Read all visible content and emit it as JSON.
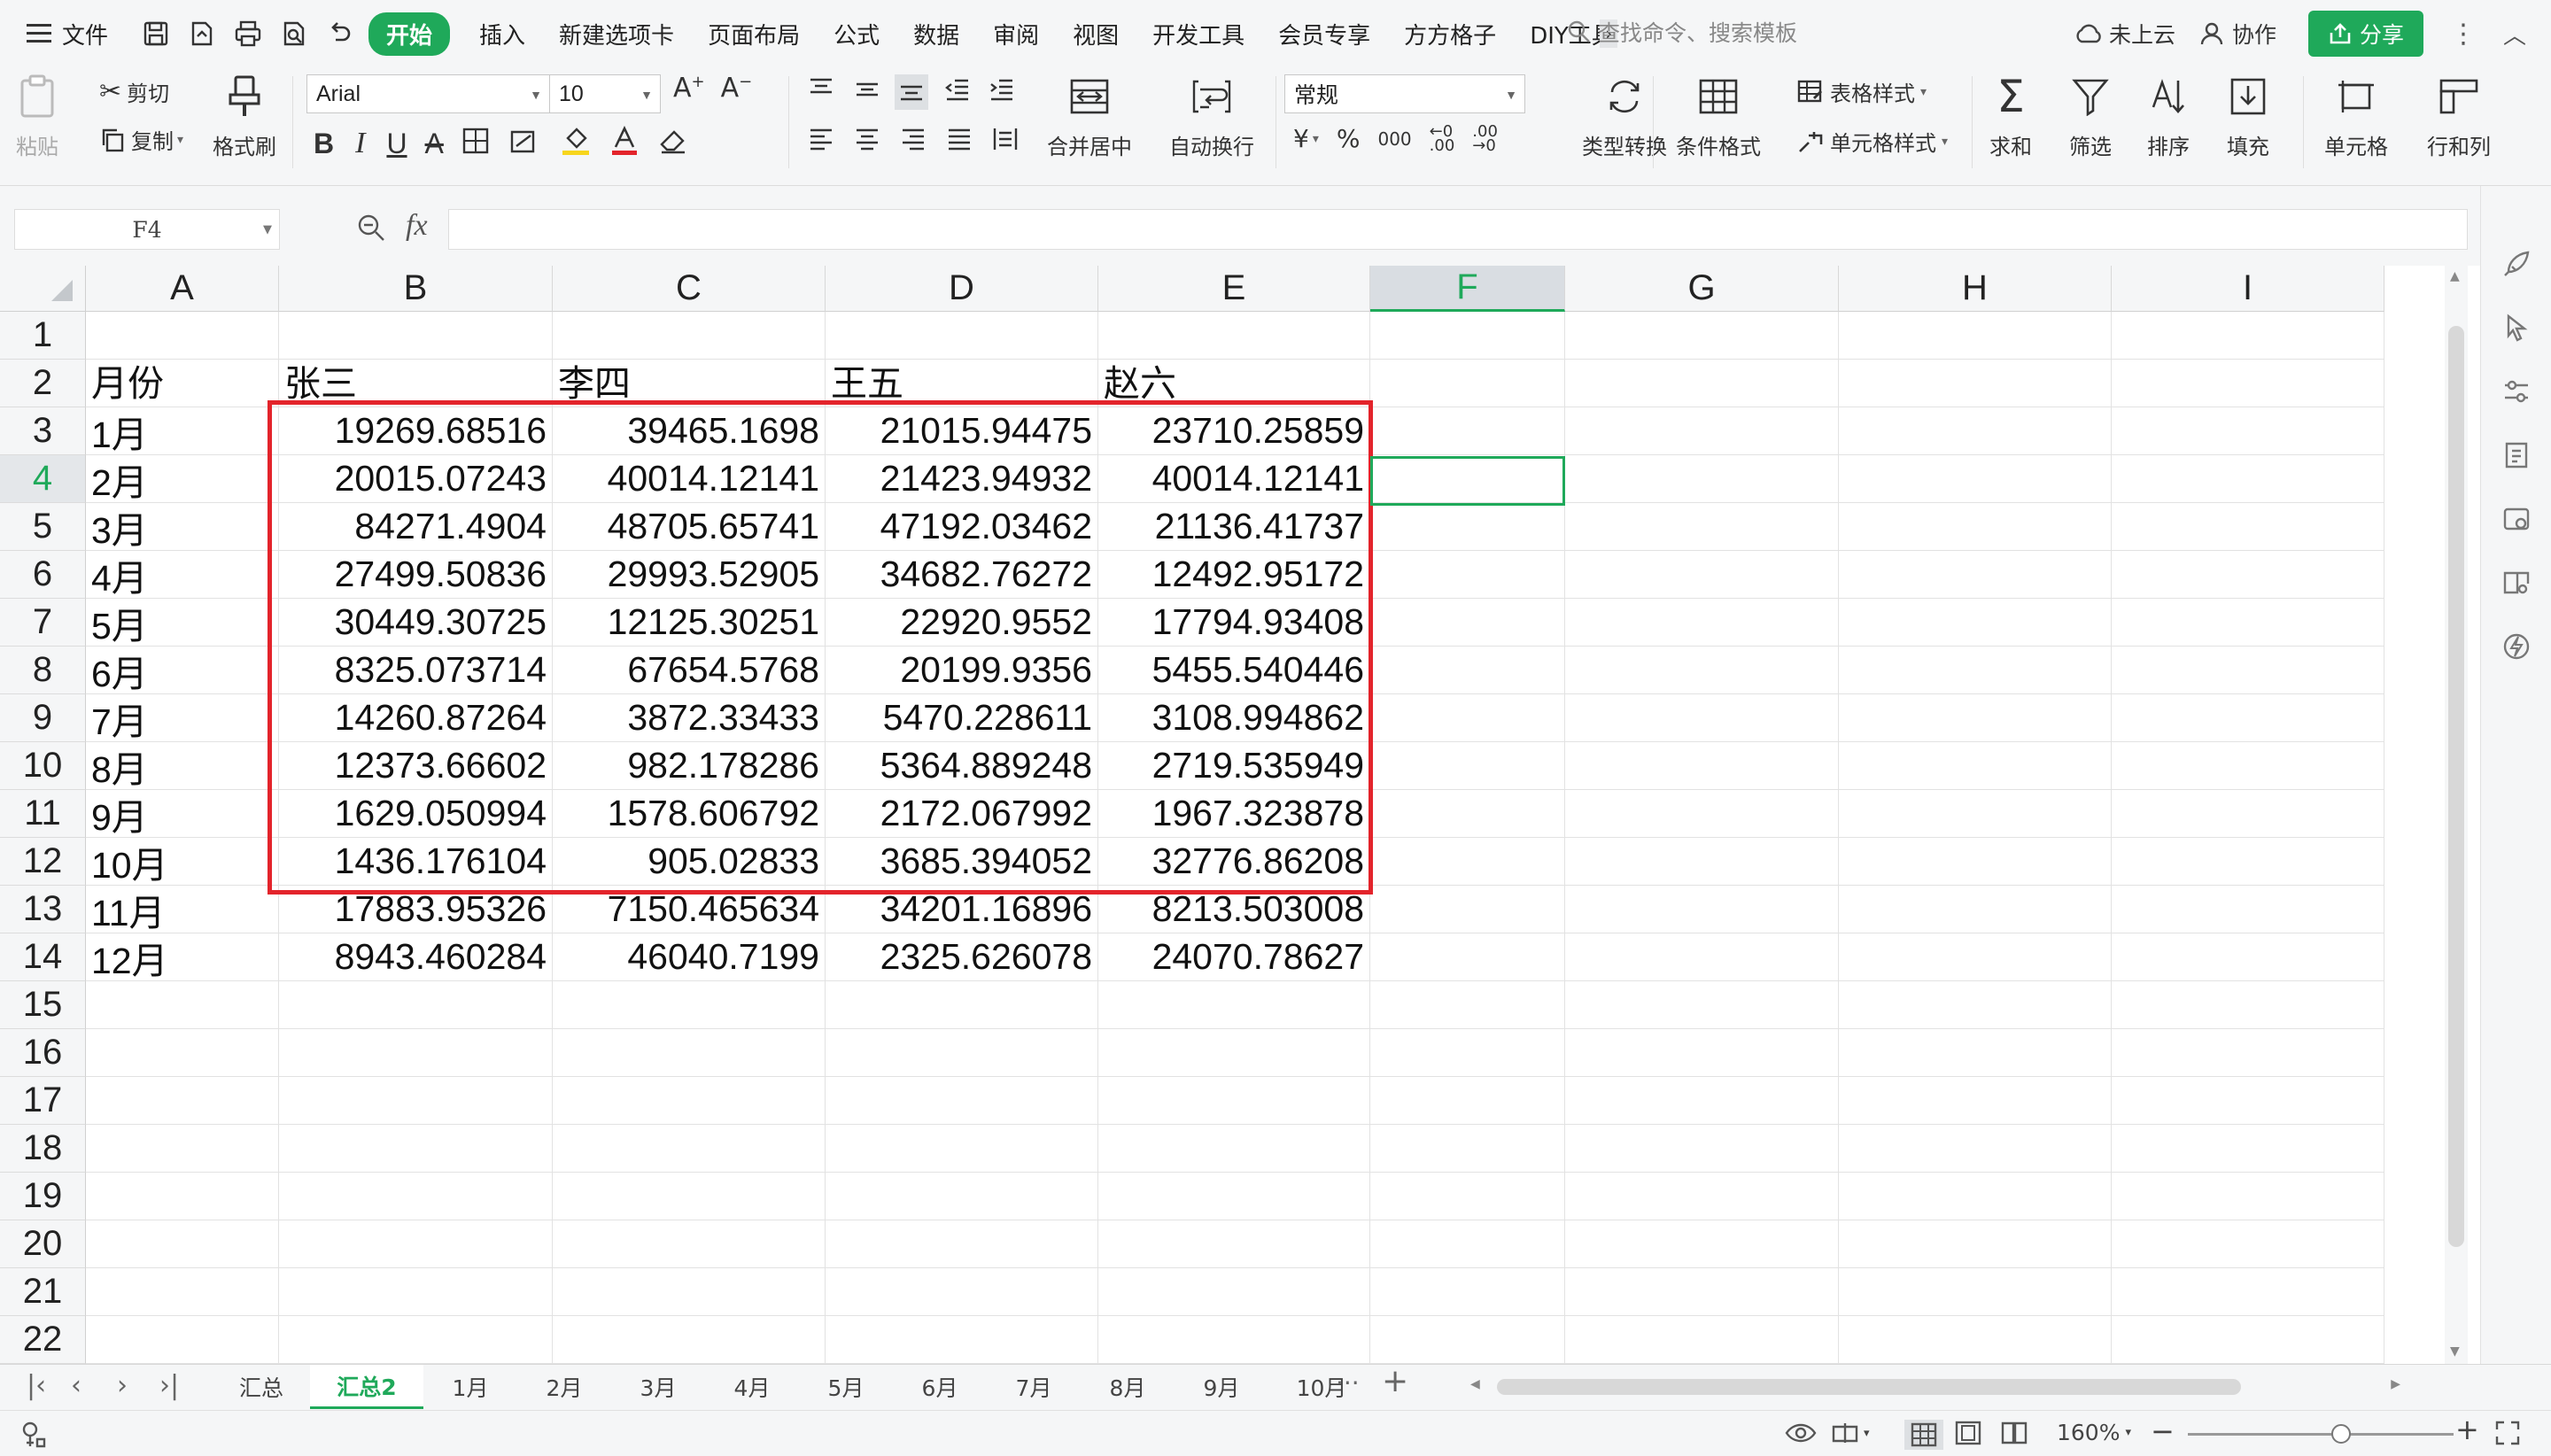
{
  "menu": {
    "file": "文件",
    "tabs": [
      "开始",
      "插入",
      "新建选项卡",
      "页面布局",
      "公式",
      "数据",
      "审阅",
      "视图",
      "开发工具",
      "会员专享",
      "方方格子",
      "DIY工具"
    ],
    "active_tab": "开始",
    "search_placeholder": "查找命令、搜索模板",
    "cloud": "未上云",
    "collab": "协作",
    "share": "分享"
  },
  "ribbon": {
    "paste": "粘贴",
    "cut": "剪切",
    "copy": "复制",
    "format_painter": "格式刷",
    "font_name": "Arial",
    "font_size": "10",
    "merge_center": "合并居中",
    "wrap_text": "自动换行",
    "number_format": "常规",
    "type_convert": "类型转换",
    "cond_format": "条件格式",
    "table_style": "表格样式",
    "cell_style": "单元格样式",
    "sum": "求和",
    "filter": "筛选",
    "sort": "排序",
    "fill": "填充",
    "cell": "单元格",
    "row_col": "行和列",
    "currency": "¥",
    "percent": "%",
    "thousands": "000"
  },
  "formula_bar": {
    "name_box": "F4",
    "fx": "fx",
    "formula": ""
  },
  "sheet": {
    "columns": [
      "A",
      "B",
      "C",
      "D",
      "E",
      "F",
      "G",
      "H",
      "I"
    ],
    "selected_col": "F",
    "selected_row": "4",
    "row_numbers": [
      "1",
      "2",
      "3",
      "4",
      "5",
      "6",
      "7",
      "8",
      "9",
      "10",
      "11",
      "12",
      "13",
      "14",
      "15",
      "16",
      "17",
      "18",
      "19",
      "20",
      "21",
      "22"
    ],
    "header_row": [
      "月份",
      "张三",
      "李四",
      "王五",
      "赵六"
    ],
    "rows": [
      [
        "1月",
        "19269.68516",
        "39465.1698",
        "21015.94475",
        "23710.25859"
      ],
      [
        "2月",
        "20015.07243",
        "40014.12141",
        "21423.94932",
        "40014.12141"
      ],
      [
        "3月",
        "84271.4904",
        "48705.65741",
        "47192.03462",
        "21136.41737"
      ],
      [
        "4月",
        "27499.50836",
        "29993.52905",
        "34682.76272",
        "12492.95172"
      ],
      [
        "5月",
        "30449.30725",
        "12125.30251",
        "22920.9552",
        "17794.93408"
      ],
      [
        "6月",
        "8325.073714",
        "67654.5768",
        "20199.9356",
        "5455.540446"
      ],
      [
        "7月",
        "14260.87264",
        "3872.33433",
        "5470.228611",
        "3108.994862"
      ],
      [
        "8月",
        "12373.66602",
        "982.178286",
        "5364.889248",
        "2719.535949"
      ],
      [
        "9月",
        "1629.050994",
        "1578.606792",
        "2172.067992",
        "1967.323878"
      ],
      [
        "10月",
        "1436.176104",
        "905.02833",
        "3685.394052",
        "32776.86208"
      ],
      [
        "11月",
        "17883.95326",
        "7150.465634",
        "34201.16896",
        "8213.503008"
      ],
      [
        "12月",
        "8943.460284",
        "46040.7199",
        "2325.626078",
        "24070.78627"
      ]
    ]
  },
  "sheet_tabs": {
    "tabs": [
      "汇总",
      "汇总2",
      "1月",
      "2月",
      "3月",
      "4月",
      "5月",
      "6月",
      "7月",
      "8月",
      "9月",
      "10月"
    ],
    "active": "汇总2",
    "more": "···",
    "add": "+"
  },
  "status": {
    "zoom": "160%",
    "minus": "−",
    "plus": "+"
  },
  "colors": {
    "accent": "#1fa95a",
    "highlight_border": "#e3242b"
  }
}
